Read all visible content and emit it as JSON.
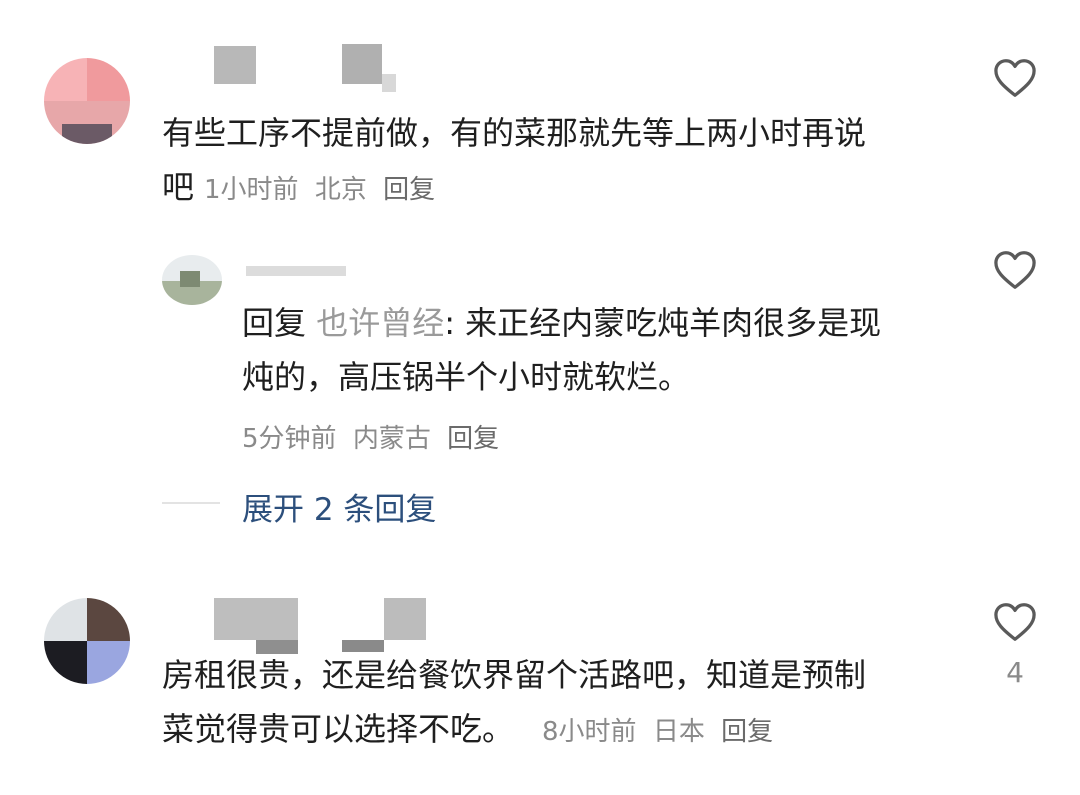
{
  "comments": [
    {
      "text_line1": "有些工序不提前做，有的菜那就先等上两小时再说",
      "text_line2": "吧",
      "time": "1小时前",
      "location": "北京",
      "reply_label": "回复"
    },
    {
      "text_line1": "房租很贵，还是给餐饮界留个活路吧，知道是预制",
      "text_line2": "菜觉得贵可以选择不吃。",
      "time": "8小时前",
      "location": "日本",
      "reply_label": "回复",
      "like_count": "4"
    }
  ],
  "sub_reply": {
    "prefix": "回复",
    "reply_to": "也许曾经",
    "separator": ":",
    "text_line1": "来正经内蒙吃炖羊肉很多是现",
    "text_line2": "炖的，高压锅半个小时就软烂。",
    "time": "5分钟前",
    "location": "内蒙古",
    "reply_label": "回复"
  },
  "expand_replies": {
    "label": "展开 2 条回复"
  },
  "colors": {
    "link": "#2c4f7c",
    "meta": "#8a8a8a",
    "heart_stroke": "#5a5a5a"
  },
  "icons": {
    "like": "heart-outline-icon"
  }
}
